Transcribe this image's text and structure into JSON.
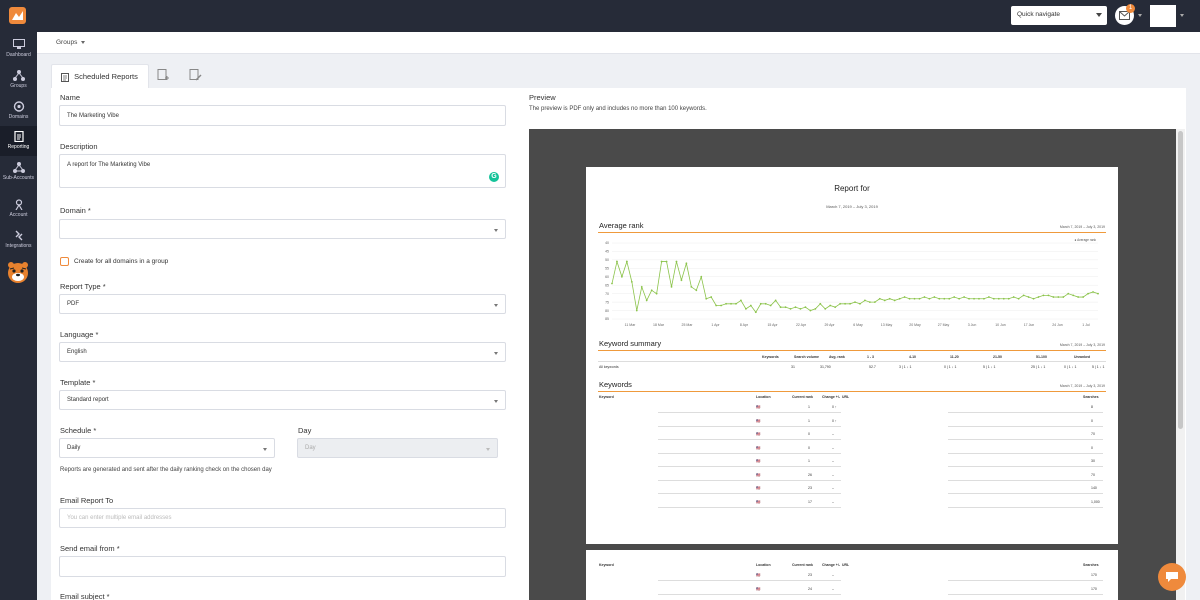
{
  "topbar": {
    "quick_navigate": "Quick navigate",
    "mail_count": "1"
  },
  "sidebar": {
    "items": [
      {
        "label": "Dashboard",
        "icon": "monitor-icon"
      },
      {
        "label": "Groups",
        "icon": "hierarchy-icon"
      },
      {
        "label": "Domains",
        "icon": "globe-icon"
      },
      {
        "label": "Reporting",
        "icon": "document-icon"
      },
      {
        "label": "Sub-Accounts",
        "icon": "network-icon"
      },
      {
        "label": "Account",
        "icon": "user-icon"
      },
      {
        "label": "Integrations",
        "icon": "plug-icon"
      }
    ]
  },
  "breadcrumb": "Groups",
  "tabs": {
    "active_label": "Scheduled Reports"
  },
  "form": {
    "name_label": "Name",
    "name_value": "The Marketing Vibe",
    "description_label": "Description",
    "description_value": "A report for The Marketing Vibe",
    "domain_label": "Domain *",
    "domain_value": "",
    "create_all_label": "Create for all domains in a group",
    "report_type_label": "Report Type *",
    "report_type_value": "PDF",
    "language_label": "Language *",
    "language_value": "English",
    "template_label": "Template *",
    "template_value": "Standard report",
    "schedule_label": "Schedule *",
    "schedule_value": "Daily",
    "day_label": "Day",
    "day_value": "Day",
    "schedule_help": "Reports are generated and sent after the daily ranking check on the chosen day",
    "email_to_label": "Email Report To",
    "email_to_placeholder": "You can enter multiple email addresses",
    "send_from_label": "Send email from *",
    "send_from_value": "",
    "subject_label": "Email subject *"
  },
  "preview": {
    "title": "Preview",
    "subtitle": "The preview is PDF only and includes no more than 100 keywords.",
    "report_title": "Report for",
    "report_date": "March 7, 2019 – July 3, 2019",
    "avg_rank_heading": "Average rank",
    "avg_rank_date": "March 7, 2019 – July 3, 2019",
    "legend": "Average rank",
    "kw_summary_heading": "Keyword summary",
    "kw_summary_date": "March 7, 2019 – July 3, 2019",
    "summary_headers": [
      "Keywords",
      "Search volume",
      "Avg. rank",
      "1 - 3",
      "4-10",
      "11-20",
      "21-50",
      "51-100",
      "Unranked"
    ],
    "summary_row": [
      "All keywords",
      "31",
      "31,790",
      "52.7",
      "3 | 1 ↓ 1",
      "0 | 1 ↓ 1",
      "5 | 1 ↓ 1",
      "25 | 1 ↓ 1",
      "0 | 1 ↓ 1",
      "5 | 1 ↓ 1"
    ],
    "keywords_heading": "Keywords",
    "keywords_date": "March 7, 2019 – July 3, 2019",
    "kw_headers": [
      "Keyword",
      "Location",
      "Current rank",
      "Change +/-",
      "URL",
      "Searches"
    ],
    "kw_rows": [
      {
        "rank": "1",
        "change": "0 ↑",
        "searches": "8"
      },
      {
        "rank": "1",
        "change": "0 ↑",
        "searches": "0"
      },
      {
        "rank": "0",
        "change": "–",
        "searches": "70"
      },
      {
        "rank": "0",
        "change": "–",
        "searches": "0"
      },
      {
        "rank": "1",
        "change": "–",
        "searches": "30"
      },
      {
        "rank": "26",
        "change": "–",
        "searches": "70"
      },
      {
        "rank": "23",
        "change": "–",
        "searches": "140"
      },
      {
        "rank": "17",
        "change": "–",
        "searches": "1,000"
      }
    ],
    "page2_rows": [
      {
        "rank": "23",
        "change": "–",
        "searches": "170"
      },
      {
        "rank": "24",
        "change": "–",
        "searches": "170"
      }
    ],
    "x_ticks": [
      "11 Mar",
      "18 Mar",
      "25 Mar",
      "1 Apr",
      "8 Apr",
      "15 Apr",
      "22 Apr",
      "29 Apr",
      "6 May",
      "13 May",
      "20 May",
      "27 May",
      "3 Jun",
      "10 Jun",
      "17 Jun",
      "24 Jun",
      "1 Jul"
    ],
    "y_ticks": [
      "40",
      "45",
      "50",
      "55",
      "60",
      "65",
      "70",
      "75",
      "80",
      "85"
    ]
  },
  "chart_data": {
    "type": "line",
    "series": [
      {
        "name": "Average rank",
        "values": [
          64,
          51,
          60,
          51,
          63,
          80,
          66,
          74,
          68,
          70,
          51,
          51,
          66,
          51,
          62,
          52,
          66,
          68,
          60,
          73,
          72,
          77,
          77,
          76,
          76,
          76,
          74,
          79,
          77,
          81,
          76,
          76,
          77,
          74,
          78,
          78,
          79,
          78,
          79,
          78,
          80,
          79,
          76,
          79,
          77,
          78,
          76,
          76,
          76,
          75,
          76,
          74,
          75,
          75,
          73,
          74,
          73,
          74,
          73,
          72,
          73,
          73,
          73,
          72,
          73,
          72,
          73,
          73,
          73,
          72,
          73,
          72,
          73,
          73,
          73,
          73,
          72,
          73,
          73,
          73,
          73,
          72,
          73,
          71,
          72,
          73,
          72,
          71,
          71,
          72,
          72,
          72,
          70,
          71,
          72,
          72,
          70,
          69,
          70
        ]
      }
    ],
    "ylim": [
      40,
      85
    ],
    "grid": true,
    "legend": "top-right"
  }
}
